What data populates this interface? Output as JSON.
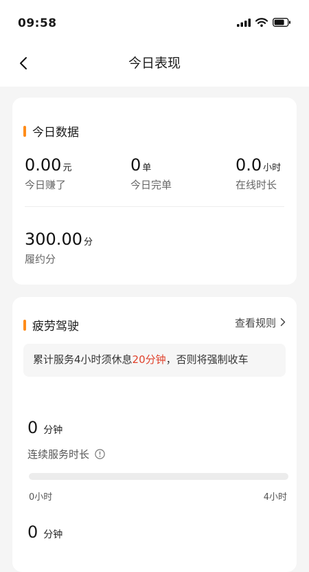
{
  "status_bar": {
    "time": "09:58"
  },
  "header": {
    "title": "今日表现",
    "back_icon": "chevron-left-icon"
  },
  "today_data": {
    "title": "今日数据",
    "accent_color": "#ff8c1a",
    "stats": [
      {
        "value": "0.00",
        "unit": "元",
        "label": "今日赚了"
      },
      {
        "value": "0",
        "unit": "单",
        "label": "今日完单"
      },
      {
        "value": "0.0",
        "unit": "小时",
        "label": "在线时长"
      }
    ],
    "score": {
      "value": "300.00",
      "unit": "分",
      "label": "履约分"
    }
  },
  "fatigue": {
    "title": "疲劳驾驶",
    "rules_link": "查看规则",
    "notice_prefix": "累计服务4小时须休息",
    "notice_highlight": "20分钟",
    "notice_suffix": "，否则将强制收车",
    "highlight_color": "#e0412b",
    "continuous": {
      "value": "0",
      "unit": "分钟",
      "label": "连续服务时长",
      "progress": 0,
      "progress_min": "0小时",
      "progress_max": "4小时"
    },
    "second": {
      "value": "0",
      "unit": "分钟"
    }
  }
}
